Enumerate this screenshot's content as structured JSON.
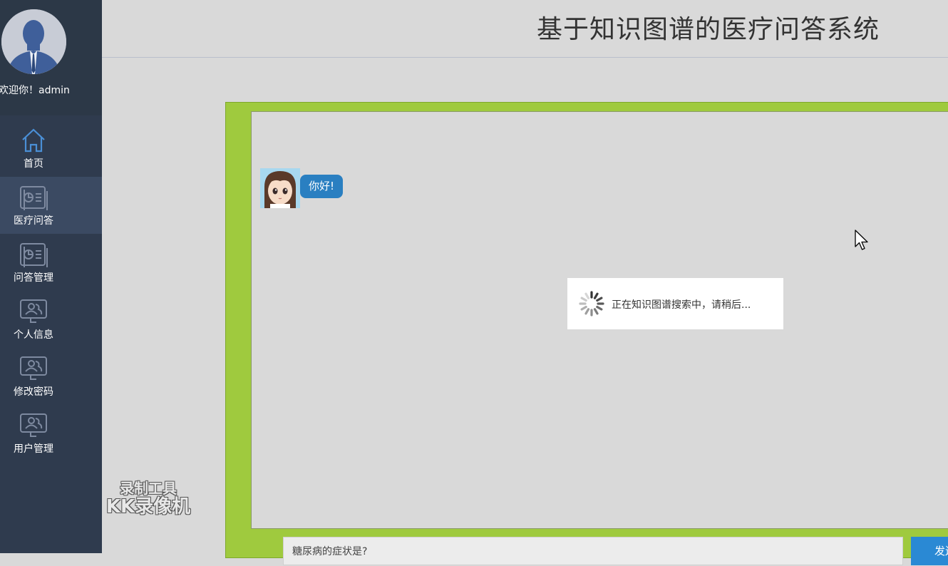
{
  "header": {
    "title": "基于知识图谱的医疗问答系统"
  },
  "profile": {
    "welcome": "欢迎你！admin"
  },
  "sidebar": {
    "items": [
      {
        "label": "首页",
        "icon": "home-icon"
      },
      {
        "label": "医疗问答",
        "icon": "report-icon",
        "active": true
      },
      {
        "label": "问答管理",
        "icon": "report-icon"
      },
      {
        "label": "个人信息",
        "icon": "monitor-user-icon"
      },
      {
        "label": "修改密码",
        "icon": "monitor-user-icon"
      },
      {
        "label": "用户管理",
        "icon": "monitor-user-icon"
      }
    ]
  },
  "chat": {
    "bot_message": "你好!",
    "loading_text": "正在知识图谱搜索中，请稍后...",
    "input_value": "糖尿病的症状是?",
    "send_label": "发送"
  },
  "watermark": {
    "line1": "录制工具",
    "line2": "KK录像机"
  },
  "colors": {
    "sidebar": "#2f3b4e",
    "sidebar_active": "#3b4a62",
    "frame_green": "#9fca3e",
    "bubble_blue": "#2a7fc1",
    "send_blue": "#2a89d4"
  }
}
